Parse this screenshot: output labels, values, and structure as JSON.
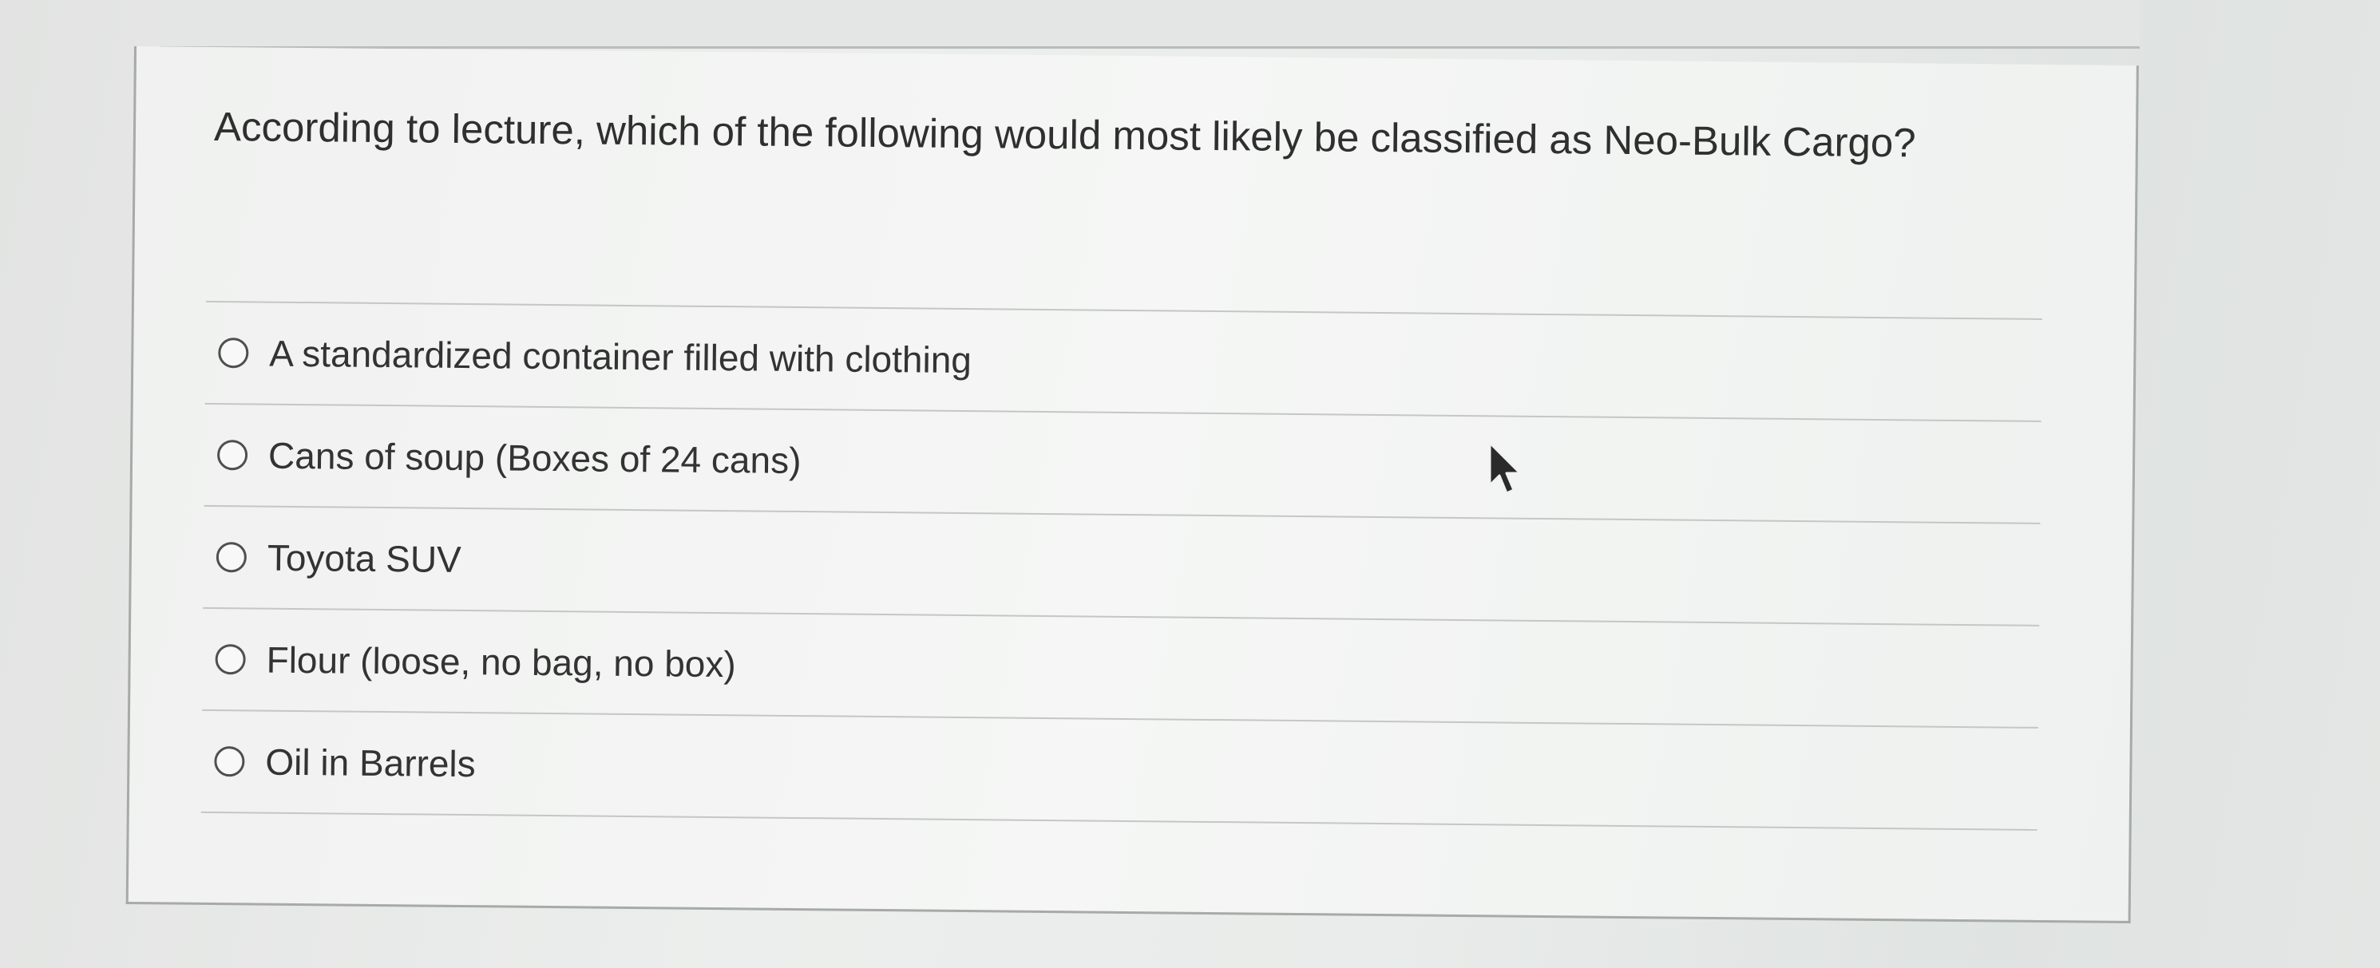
{
  "question": {
    "text": "According to lecture, which of the following would most likely be classified as Neo-Bulk Cargo?"
  },
  "options": [
    {
      "label": "A standardized container filled with clothing",
      "selected": false
    },
    {
      "label": "Cans of soup (Boxes of 24 cans)",
      "selected": false
    },
    {
      "label": "Toyota SUV",
      "selected": false
    },
    {
      "label": "Flour (loose, no bag, no box)",
      "selected": false
    },
    {
      "label": "Oil in Barrels",
      "selected": false
    }
  ],
  "cursor": {
    "icon": "mouse-pointer-icon"
  },
  "colors": {
    "text": "#2f2f2f",
    "border": "#a6aaa8",
    "background": "#e4e6e5"
  }
}
